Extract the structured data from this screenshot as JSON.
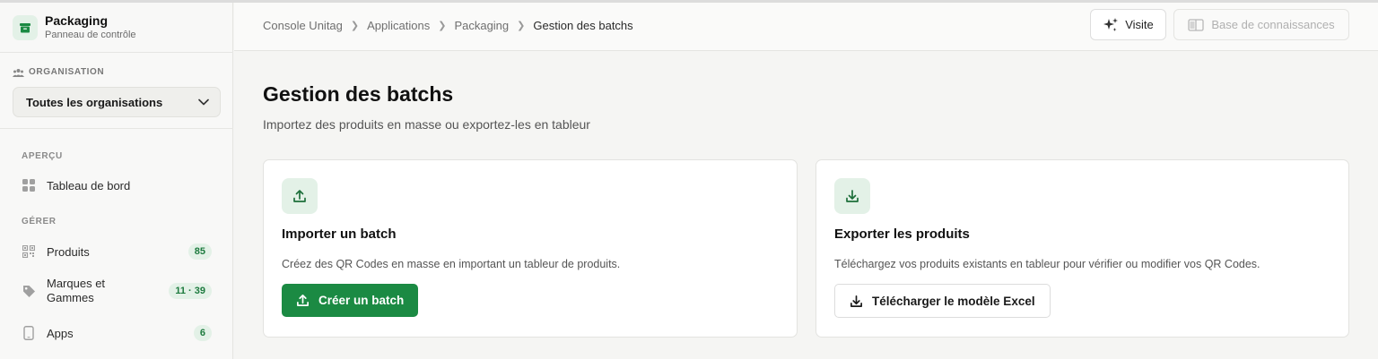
{
  "app": {
    "title": "Packaging",
    "subtitle": "Panneau de contrôle"
  },
  "organisation": {
    "label": "ORGANISATION",
    "selected": "Toutes les organisations"
  },
  "sidebar": {
    "sections": [
      {
        "label": "APERÇU"
      },
      {
        "label": "GÉRER"
      }
    ],
    "items": [
      {
        "label": "Tableau de bord",
        "icon": "grid-icon"
      },
      {
        "label": "Produits",
        "badge": "85",
        "icon": "qr-code-icon"
      },
      {
        "label": "Marques et\nGammes",
        "badge": "11 · 39",
        "icon": "tag-icon"
      },
      {
        "label": "Apps",
        "badge": "6",
        "icon": "phone-icon"
      }
    ]
  },
  "breadcrumb": [
    "Console Unitag",
    "Applications",
    "Packaging",
    "Gestion des batchs"
  ],
  "header": {
    "visit_label": "Visite",
    "kb_label": "Base de connaissances"
  },
  "page": {
    "title": "Gestion des batchs",
    "subtitle": "Importez des produits en masse ou exportez-les en tableur"
  },
  "cards": [
    {
      "title": "Importer un batch",
      "description": "Créez des QR Codes en masse en important un tableur de produits.",
      "button": "Créer un batch",
      "icon": "upload-icon"
    },
    {
      "title": "Exporter les produits",
      "description": "Téléchargez vos produits existants en tableur pour vérifier ou modifier vos QR Codes.",
      "button": "Télécharger le modèle Excel",
      "icon": "download-icon"
    }
  ],
  "colors": {
    "accent": "#1b8a43",
    "accent_soft": "#e3f1e7",
    "background": "#f5f5f3"
  }
}
